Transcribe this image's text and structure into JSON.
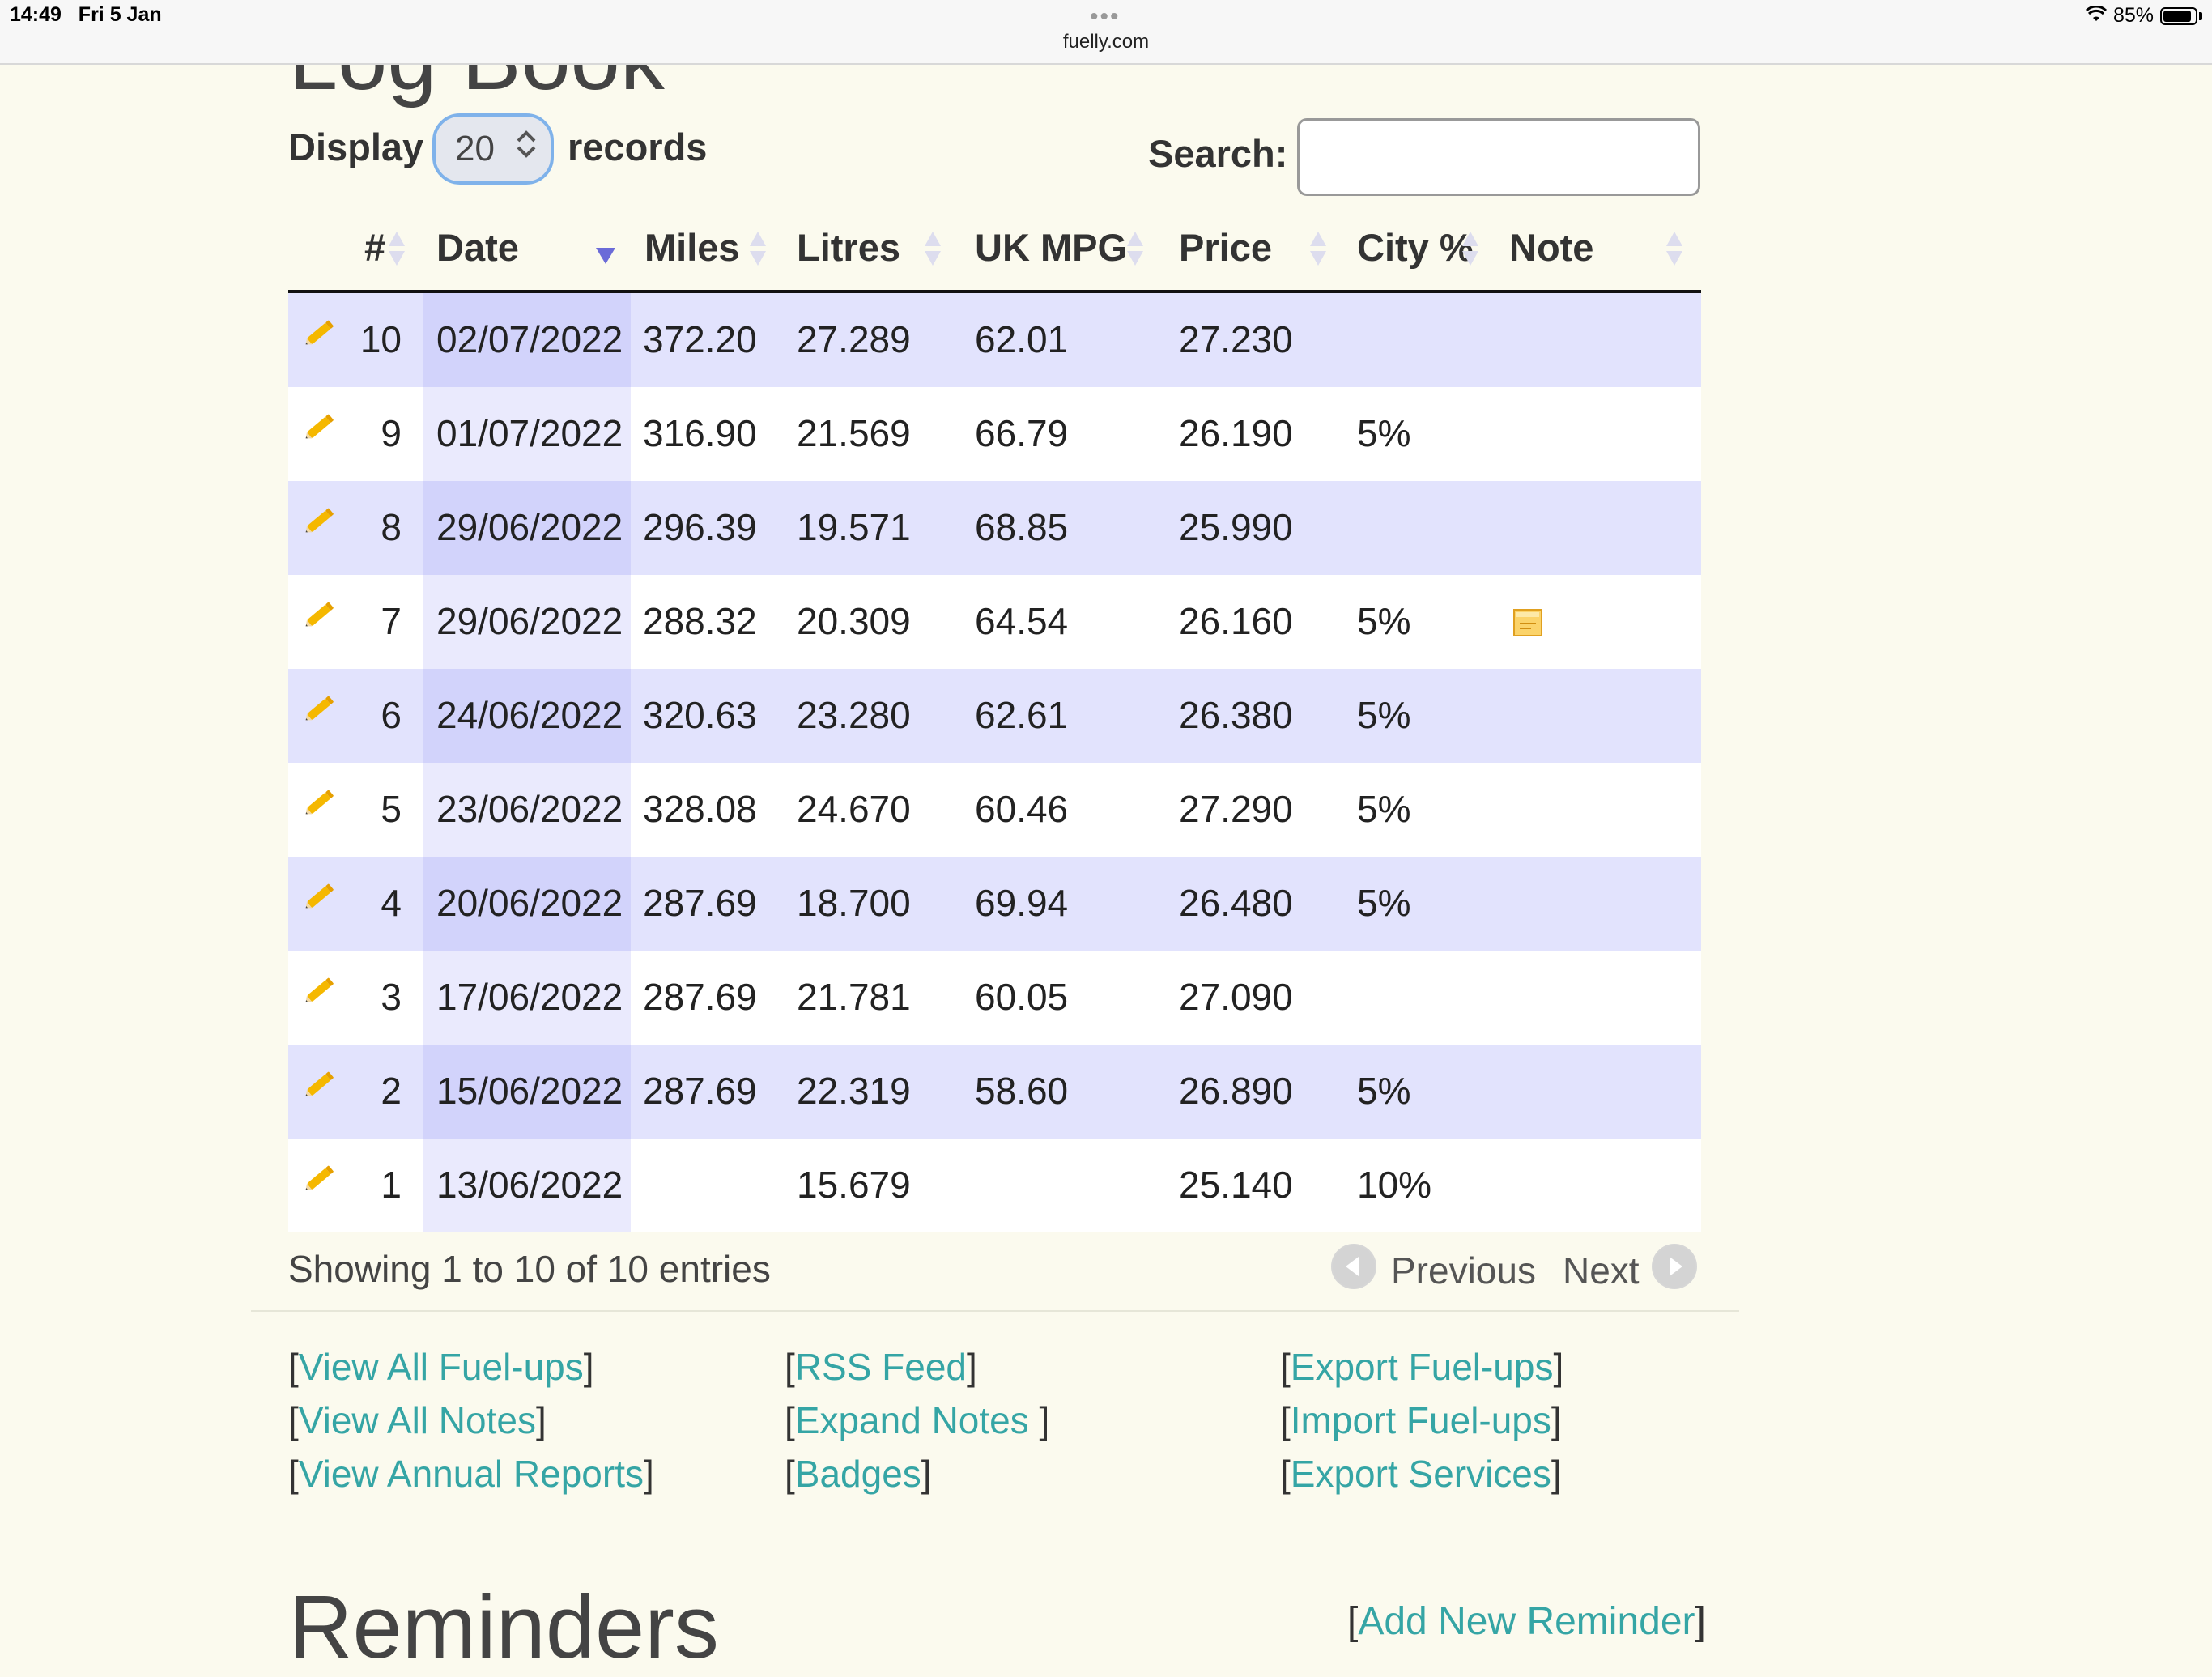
{
  "status_bar": {
    "time": "14:49",
    "date": "Fri 5 Jan",
    "url": "fuelly.com",
    "battery": "85%"
  },
  "page": {
    "heading": "Log Book",
    "reminders_title": "Reminders",
    "add_reminder": "Add New Reminder"
  },
  "controls": {
    "display_label": "Display",
    "display_value": "20",
    "records_label": "records",
    "search_label": "Search:",
    "search_value": ""
  },
  "table": {
    "headers": [
      "#",
      "Date",
      "Miles",
      "Litres",
      "UK MPG",
      "Price",
      "City %",
      "Note"
    ],
    "rows": [
      {
        "num": "10",
        "date": "02/07/2022",
        "miles": "372.20",
        "litres": "27.289",
        "mpg": "62.01",
        "price": "27.230",
        "city": "",
        "note": false
      },
      {
        "num": "9",
        "date": "01/07/2022",
        "miles": "316.90",
        "litres": "21.569",
        "mpg": "66.79",
        "price": "26.190",
        "city": "5%",
        "note": false
      },
      {
        "num": "8",
        "date": "29/06/2022",
        "miles": "296.39",
        "litres": "19.571",
        "mpg": "68.85",
        "price": "25.990",
        "city": "",
        "note": false
      },
      {
        "num": "7",
        "date": "29/06/2022",
        "miles": "288.32",
        "litres": "20.309",
        "mpg": "64.54",
        "price": "26.160",
        "city": "5%",
        "note": true
      },
      {
        "num": "6",
        "date": "24/06/2022",
        "miles": "320.63",
        "litres": "23.280",
        "mpg": "62.61",
        "price": "26.380",
        "city": "5%",
        "note": false
      },
      {
        "num": "5",
        "date": "23/06/2022",
        "miles": "328.08",
        "litres": "24.670",
        "mpg": "60.46",
        "price": "27.290",
        "city": "5%",
        "note": false
      },
      {
        "num": "4",
        "date": "20/06/2022",
        "miles": "287.69",
        "litres": "18.700",
        "mpg": "69.94",
        "price": "26.480",
        "city": "5%",
        "note": false
      },
      {
        "num": "3",
        "date": "17/06/2022",
        "miles": "287.69",
        "litres": "21.781",
        "mpg": "60.05",
        "price": "27.090",
        "city": "",
        "note": false
      },
      {
        "num": "2",
        "date": "15/06/2022",
        "miles": "287.69",
        "litres": "22.319",
        "mpg": "58.60",
        "price": "26.890",
        "city": "5%",
        "note": false
      },
      {
        "num": "1",
        "date": "13/06/2022",
        "miles": "",
        "litres": "15.679",
        "mpg": "",
        "price": "25.140",
        "city": "10%",
        "note": false
      }
    ],
    "info": "Showing 1 to 10 of 10 entries",
    "previous": "Previous",
    "next": "Next"
  },
  "links": {
    "col1": [
      "View All Fuel-ups",
      "View All Notes",
      "View Annual Reports"
    ],
    "col2": [
      "RSS Feed",
      "Expand Notes ",
      "Badges"
    ],
    "col3": [
      "Export Fuel-ups",
      "Import Fuel-ups",
      "Export Services"
    ]
  },
  "colors": {
    "link": "#35a5a5",
    "row_odd": "#e2e3fd",
    "sorted_col": "#d2d3fb",
    "pencil": "#f5b800",
    "background": "#fbfaee"
  }
}
